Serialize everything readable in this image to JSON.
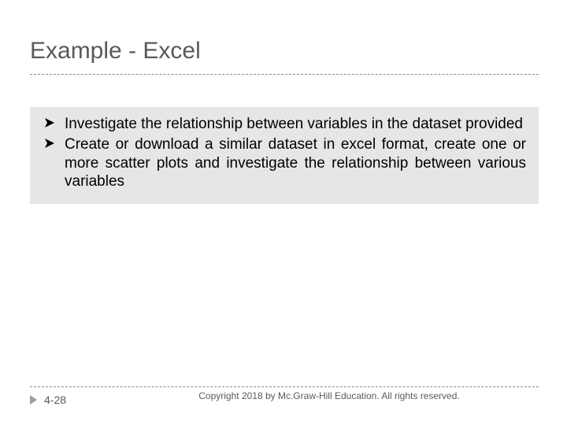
{
  "title": "Example - Excel",
  "bullets": [
    "Investigate the relationship between variables in the dataset provided",
    "Create or download a similar dataset in excel format, create one or more scatter plots and investigate the relationship between various variables"
  ],
  "footer": {
    "page": "4-28",
    "copyright": "Copyright 2018 by Mc.Graw-Hill Education. All rights reserved."
  }
}
